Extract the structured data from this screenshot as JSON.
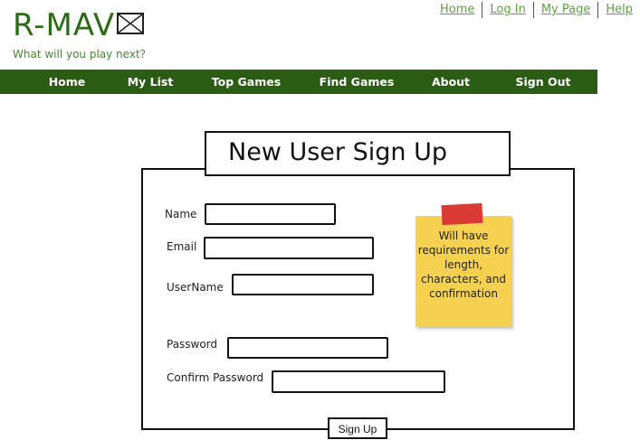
{
  "brand": {
    "name": "R-MAV",
    "tagline": "What will you play next?"
  },
  "top_links": [
    {
      "label": "Home"
    },
    {
      "label": "Log In"
    },
    {
      "label": "My Page"
    },
    {
      "label": "Help"
    }
  ],
  "nav": [
    {
      "label": "Home"
    },
    {
      "label": "My List"
    },
    {
      "label": "Top Games"
    },
    {
      "label": "Find Games"
    },
    {
      "label": "About"
    },
    {
      "label": "Sign Out"
    }
  ],
  "form": {
    "title": "New User Sign Up",
    "fields": {
      "name": {
        "label": "Name",
        "value": ""
      },
      "email": {
        "label": "Email",
        "value": ""
      },
      "username": {
        "label": "UserName",
        "value": ""
      },
      "password": {
        "label": "Password",
        "value": ""
      },
      "confirm_password": {
        "label": "Confirm Password",
        "value": ""
      }
    },
    "note": "Will have requirements for length, characters, and confirmation",
    "submit_label": "Sign Up"
  },
  "colors": {
    "brand_green": "#2c6b17",
    "nav_bg": "#2b5c14",
    "link_green": "#5aa33a",
    "note_yellow": "#f6d14f",
    "tape_red": "#d93a33"
  }
}
